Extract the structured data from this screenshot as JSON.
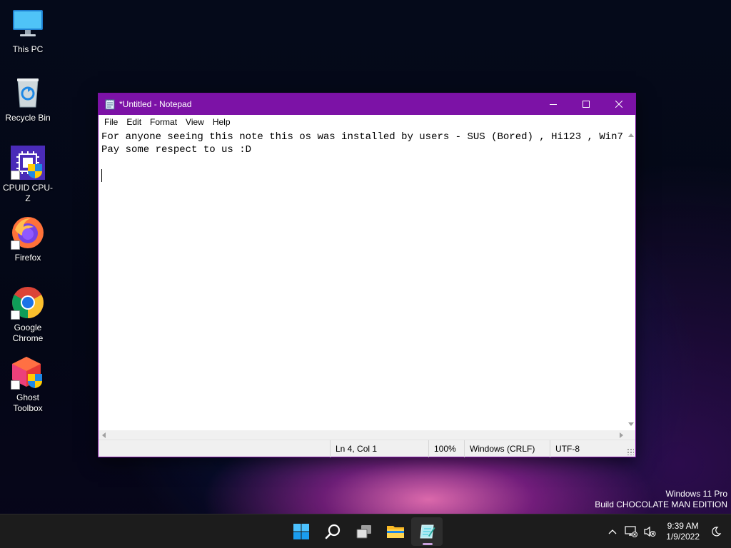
{
  "desktop": {
    "icons": [
      {
        "label": "This PC",
        "icon": "monitor-icon"
      },
      {
        "label": "Recycle Bin",
        "icon": "recycle-bin-icon"
      },
      {
        "label": "CPUID CPU-Z",
        "icon": "cpu-z-icon"
      },
      {
        "label": "Firefox",
        "icon": "firefox-icon"
      },
      {
        "label": "Google Chrome",
        "icon": "chrome-icon"
      },
      {
        "label": "Ghost Toolbox",
        "icon": "ghost-toolbox-icon"
      }
    ]
  },
  "window": {
    "title": "*Untitled - Notepad",
    "accent_color": "#7c12a6",
    "menu": [
      "File",
      "Edit",
      "Format",
      "View",
      "Help"
    ],
    "content": {
      "line1": "For anyone seeing this note this os was installed by users - SUS (Bored) , Hi123 , Win7",
      "line2": "Pay some respect to us :D"
    },
    "status": {
      "position": "Ln 4, Col 1",
      "zoom": "100%",
      "line_ending": "Windows (CRLF)",
      "encoding": "UTF-8"
    }
  },
  "watermark": {
    "line1": "Windows 11 Pro",
    "line2": "Build CHOCOLATE MAN EDITION"
  },
  "taskbar": {
    "apps": [
      "start-icon",
      "search-icon",
      "task-view-icon",
      "file-explorer-icon",
      "notepad-icon"
    ],
    "clock": {
      "time": "9:39 AM",
      "date": "1/9/2022"
    }
  }
}
